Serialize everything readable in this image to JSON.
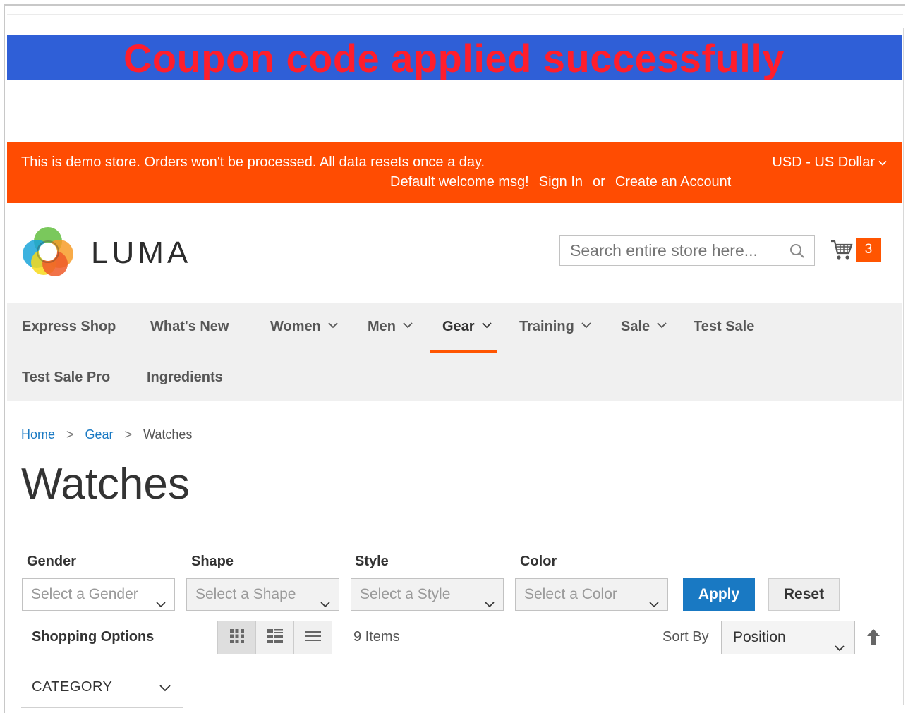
{
  "banner": {
    "coupon_message": "Coupon code applied successfully"
  },
  "header_bar": {
    "notice": "This is demo store. Orders won't be processed. All data resets once a day.",
    "currency": "USD - US Dollar",
    "welcome": "Default welcome msg!",
    "sign_in": "Sign In",
    "or": "or",
    "create_account": "Create an Account"
  },
  "brand": {
    "name": "LUMA"
  },
  "search": {
    "placeholder": "Search entire store here..."
  },
  "cart": {
    "count": "3"
  },
  "nav": {
    "items": [
      {
        "label": "Express Shop"
      },
      {
        "label": "What's New"
      },
      {
        "label": "Women"
      },
      {
        "label": "Men"
      },
      {
        "label": "Gear"
      },
      {
        "label": "Training"
      },
      {
        "label": "Sale"
      },
      {
        "label": "Test Sale"
      },
      {
        "label": "Test Sale Pro"
      },
      {
        "label": "Ingredients"
      }
    ],
    "active": "Gear"
  },
  "breadcrumb": {
    "home": "Home",
    "gear": "Gear",
    "current": "Watches",
    "separator": ">"
  },
  "page": {
    "title": "Watches"
  },
  "filters": {
    "gender": {
      "label": "Gender",
      "placeholder": "Select a Gender"
    },
    "shape": {
      "label": "Shape",
      "placeholder": "Select a Shape"
    },
    "style": {
      "label": "Style",
      "placeholder": "Select a Style"
    },
    "color": {
      "label": "Color",
      "placeholder": "Select a Color"
    },
    "apply": "Apply",
    "reset": "Reset"
  },
  "toolbar": {
    "shopping_options": "Shopping Options",
    "items_count": "9 Items",
    "sort_by_label": "Sort By",
    "sort_by_value": "Position"
  },
  "sidebar": {
    "category_label": "CATEGORY"
  },
  "colors": {
    "coupon_bg": "#2f5fd7",
    "coupon_text": "#ff1e2c",
    "header_bg": "#ff4c02",
    "accent": "#ff5501",
    "primary_button": "#1979c3"
  },
  "icons": [
    "search-icon",
    "cart-icon",
    "chevron-down-icon",
    "grid-icon",
    "list-icon",
    "arrow-up-icon",
    "luma-logo-icon"
  ]
}
